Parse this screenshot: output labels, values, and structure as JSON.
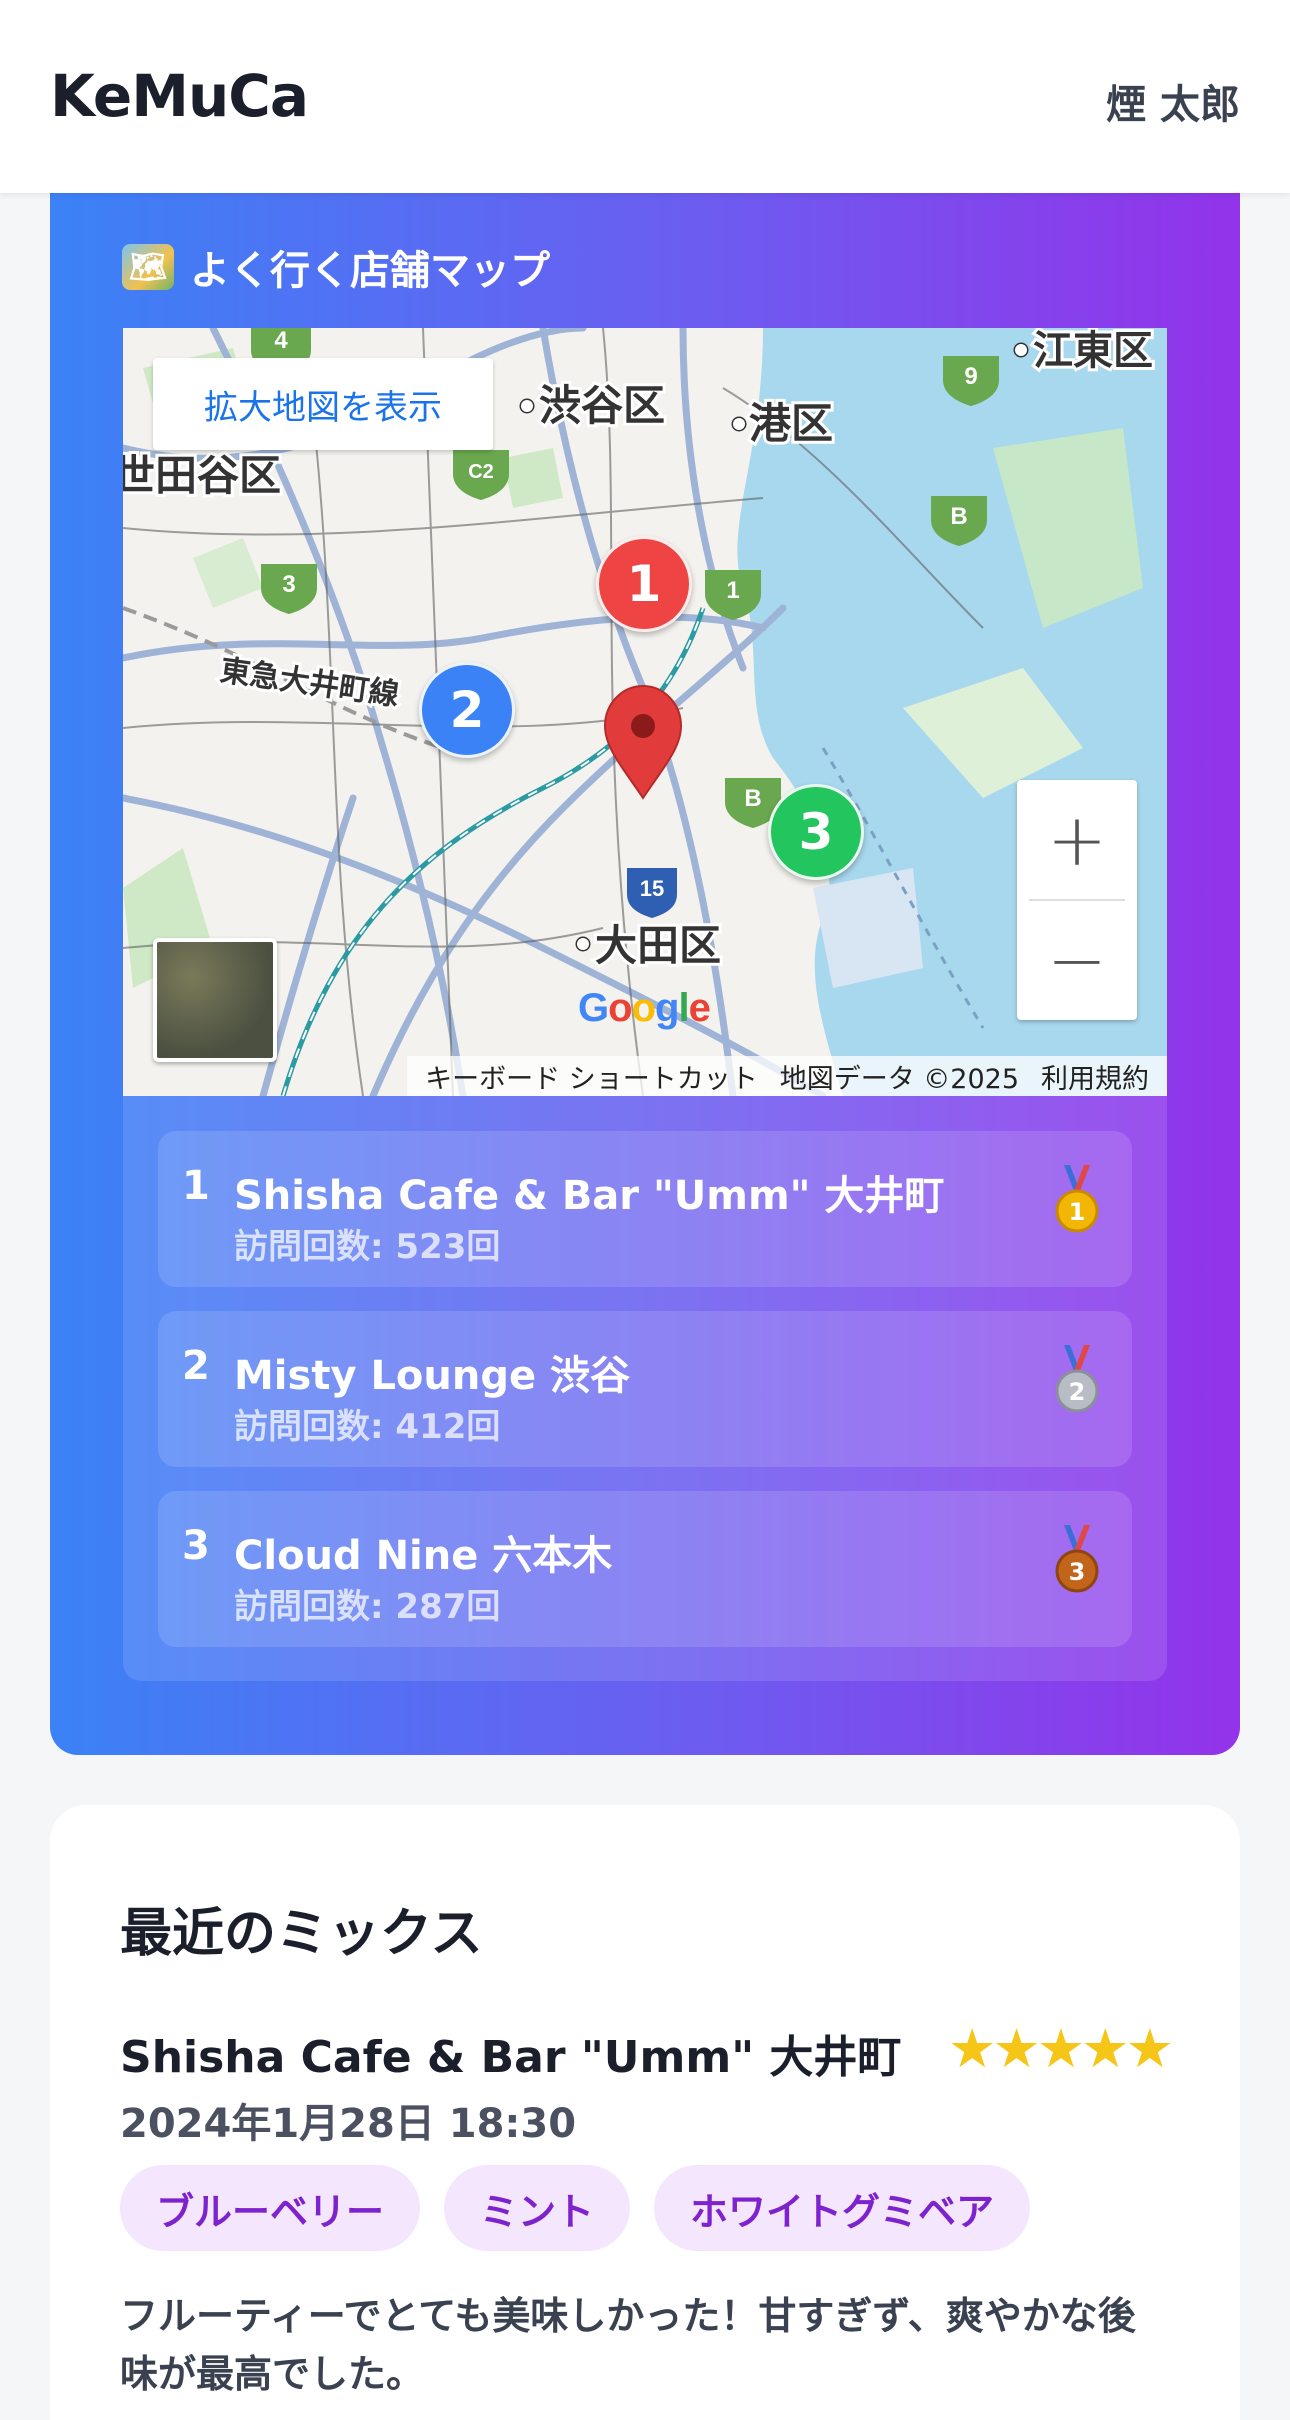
{
  "header": {
    "brand": "KeMuCa",
    "user": "煙 太郎"
  },
  "map_section": {
    "title": "よく行く店舗マップ",
    "title_icon": "world-map-icon",
    "map": {
      "expand_button": "拡大地図を表示",
      "zoom_in": "+",
      "zoom_out": "−",
      "logo": "Google",
      "attribution": {
        "shortcuts": "キーボード ショートカット",
        "data": "地図データ ©2025",
        "terms": "利用規約"
      },
      "labels": {
        "shibuya": "渋谷区",
        "minato": "港区",
        "setagaya": "世田谷区",
        "koto": "江東区",
        "ota": "大田区",
        "line": "東急大井町線",
        "r4": "4",
        "r9": "9",
        "c2": "C2",
        "b1": "B",
        "r3": "3",
        "r1": "1",
        "b2": "B",
        "r15": "15"
      },
      "pins": [
        {
          "label": "1",
          "color": "#ef4444"
        },
        {
          "label": "2",
          "color": "#3b82f6"
        },
        {
          "label": "3",
          "color": "#22c55e"
        }
      ]
    },
    "ranking": [
      {
        "rank": "1",
        "name": "Shisha Cafe & Bar \"Umm\" 大井町",
        "visits": "訪問回数: 523回",
        "medal": "gold-medal-icon"
      },
      {
        "rank": "2",
        "name": "Misty Lounge 渋谷",
        "visits": "訪問回数: 412回",
        "medal": "silver-medal-icon"
      },
      {
        "rank": "3",
        "name": "Cloud Nine 六本木",
        "visits": "訪問回数: 287回",
        "medal": "bronze-medal-icon"
      }
    ]
  },
  "recent_mixes": {
    "title": "最近のミックス",
    "entries": [
      {
        "shop": "Shisha Cafe & Bar \"Umm\" 大井町",
        "rating": "★★★★★",
        "date": "2024年1月28日 18:30",
        "flavors": [
          "ブルーベリー",
          "ミント",
          "ホワイトグミベア"
        ],
        "comment": "フルーティーでとても美味しかった！甘すぎず、爽やかな後味が最高でした。"
      }
    ]
  },
  "colors": {
    "gradient_start": "#3b82f6",
    "gradient_end": "#9333ea",
    "tag_bg": "#f3e6fd",
    "tag_text": "#7e22ce",
    "star": "#f5c518"
  }
}
